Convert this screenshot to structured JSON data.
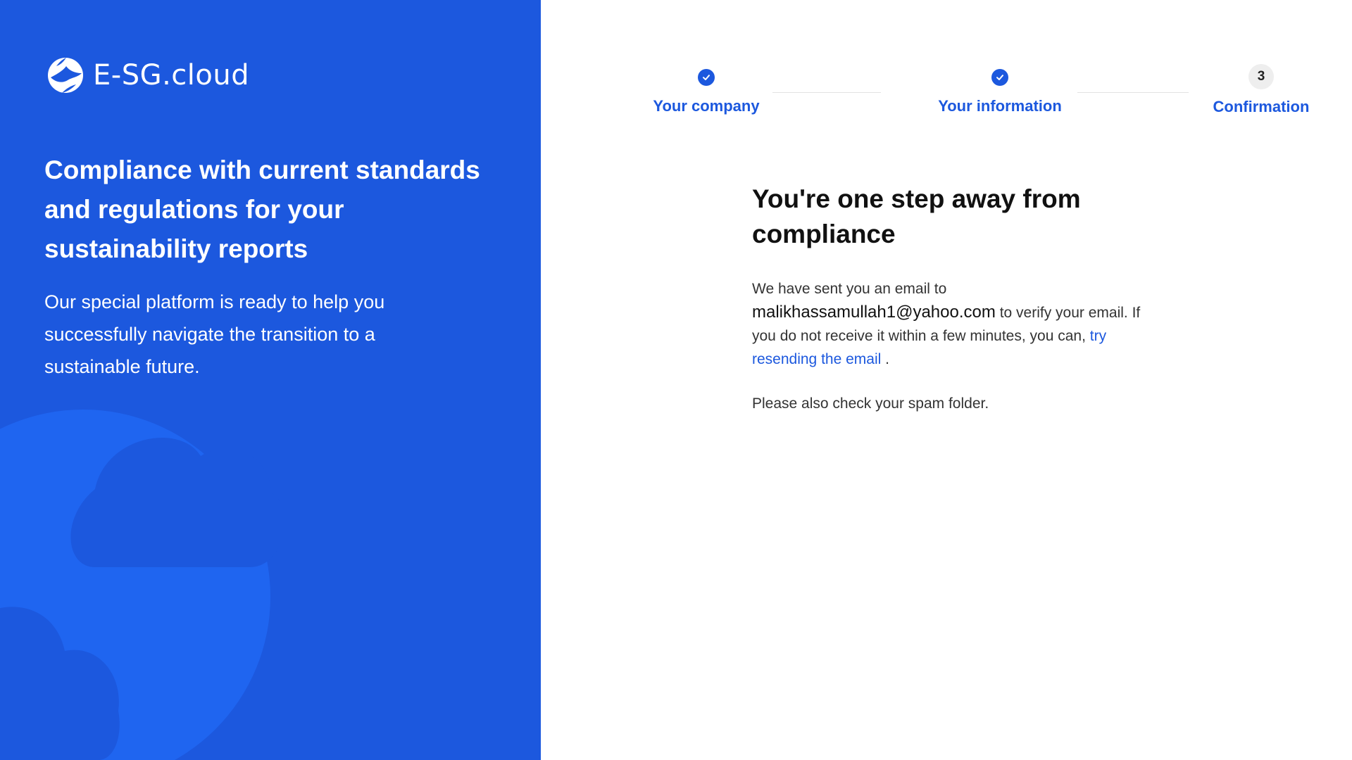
{
  "brand": {
    "name": "E-SG.cloud",
    "color": "#1c58de"
  },
  "hero": {
    "headline": "Compliance with current standards and regulations for your sustainability reports",
    "subtext": "Our special platform is ready to help you successfully navigate the transition to a sustainable future."
  },
  "stepper": {
    "steps": [
      {
        "label": "Your company",
        "status": "completed",
        "icon": "check-icon"
      },
      {
        "label": "Your information",
        "status": "completed",
        "icon": "check-icon"
      },
      {
        "label": "Confirmation",
        "status": "current",
        "number": "3"
      }
    ]
  },
  "confirmation": {
    "title": "You're one step away from compliance",
    "body_intro": "We have sent you an email to",
    "email": "malikhassamullah1@yahoo.com",
    "body_middle": "to verify your email. If you do not receive it within a few minutes, you can,",
    "resend_link": "try resending the email",
    "body_end": ".",
    "spam_note": "Please also check your spam folder."
  }
}
